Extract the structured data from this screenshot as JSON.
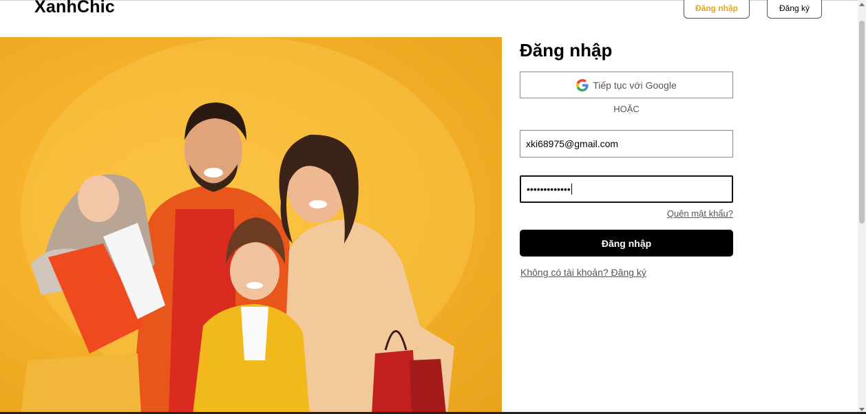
{
  "header": {
    "brand": "XanhChic",
    "login_label": "Đăng nhập",
    "signup_label": "Đăng ký"
  },
  "hero": {
    "icon": "family-shopping-photo"
  },
  "login": {
    "title": "Đăng nhập",
    "google_label": "Tiếp tục với Google",
    "or_label": "HOẶC",
    "email_value": "xki68975@gmail.com",
    "password_masked": "•••••••••••••",
    "forgot_label": "Quên mật khẩu?",
    "submit_label": "Đăng nhập",
    "signup_prompt": "Không có tài khoản? Đăng ký"
  },
  "colors": {
    "accent": "#e0a526",
    "hero_bg": "#f5b22a",
    "primary_button": "#000000"
  }
}
